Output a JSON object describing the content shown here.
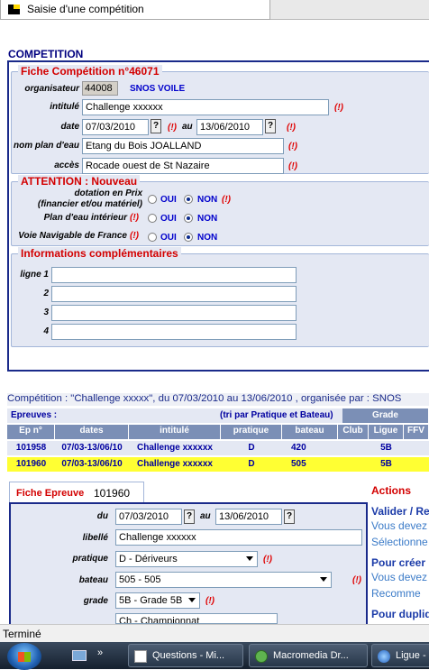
{
  "tab": {
    "title": "Saisie d'une compétition",
    "icon": "flag-icon"
  },
  "section_title": "COMPETITION",
  "fiche": {
    "legend": "Fiche Compétition n°46071",
    "organisateur_label": "organisateur",
    "organisateur_code": "44008",
    "organisateur_name": "SNOS VOILE",
    "intitule_label": "intitulé",
    "intitule_value": "Challenge xxxxxx",
    "date_label": "date",
    "date_from": "07/03/2010",
    "date_to": "13/06/2010",
    "au": "au",
    "plan_label": "nom plan d'eau",
    "plan_value": "Etang du Bois JOALLAND",
    "acces_label": "accès",
    "acces_value": "Rocade ouest de St Nazaire",
    "help": "?",
    "required": "(!)"
  },
  "attention": {
    "legend": "ATTENTION : Nouveau",
    "dotation_label_1": "dotation en Prix",
    "dotation_label_2": "(financier et/ou matériel)",
    "plan_int_label": "Plan d'eau intérieur",
    "voie_label": "Voie Navigable de France",
    "oui": "OUI",
    "non": "NON",
    "required": "(!)"
  },
  "infos": {
    "legend": "Informations complémentaires",
    "lines": [
      {
        "label": "ligne 1",
        "value": ""
      },
      {
        "label": "2",
        "value": ""
      },
      {
        "label": "3",
        "value": ""
      },
      {
        "label": "4",
        "value": ""
      }
    ]
  },
  "summary": "Compétition : \"Challenge xxxxx\",  du 07/03/2010 au 13/06/2010 , organisée par : SNOS",
  "epreuves": {
    "title": "Epreuves :",
    "sort_note": "(tri par Pratique et Bateau)",
    "grade_header": "Grade",
    "headers": [
      "Ep n°",
      "dates",
      "intitulé",
      "pratique",
      "bateau",
      "Club",
      "Ligue",
      "FFV"
    ],
    "rows": [
      {
        "ep": "101958",
        "dates": "07/03-13/06/10",
        "intitule": "Challenge xxxxxx",
        "pratique": "D",
        "bateau": "420",
        "club": "",
        "ligue": "5B",
        "ffv": ""
      },
      {
        "ep": "101960",
        "dates": "07/03-13/06/10",
        "intitule": "Challenge xxxxxx",
        "pratique": "D",
        "bateau": "505",
        "club": "",
        "ligue": "5B",
        "ffv": ""
      }
    ]
  },
  "fiche_epreuve": {
    "tab_label": "Fiche Epreuve",
    "number": "101960",
    "du_label": "du",
    "du_value": "07/03/2010",
    "au_label": "au",
    "au_value": "13/06/2010",
    "libelle_label": "libellé",
    "libelle_value": "Challenge xxxxxx",
    "pratique_label": "pratique",
    "pratique_value": "D - Dériveurs",
    "bateau_label": "bateau",
    "bateau_value": "505 - 505",
    "grade_label": "grade",
    "grade_value": "5B - Grade 5B",
    "next_value": "Ch - Championnat",
    "required": "(!)",
    "help": "?"
  },
  "actions": {
    "title": "Actions",
    "items": [
      "Valider / Re",
      "Vous devez",
      "Sélectionne",
      "Pour créer",
      "Vous devez",
      "Recomme",
      "Pour dupliq"
    ]
  },
  "status": {
    "text": "Terminé"
  },
  "taskbar": {
    "items": [
      {
        "label": "Questions - Mi...",
        "icon": "document-icon"
      },
      {
        "label": "Macromedia Dr...",
        "icon": "dreamweaver-icon"
      },
      {
        "label": "Ligue -",
        "icon": "browser-icon"
      }
    ]
  }
}
